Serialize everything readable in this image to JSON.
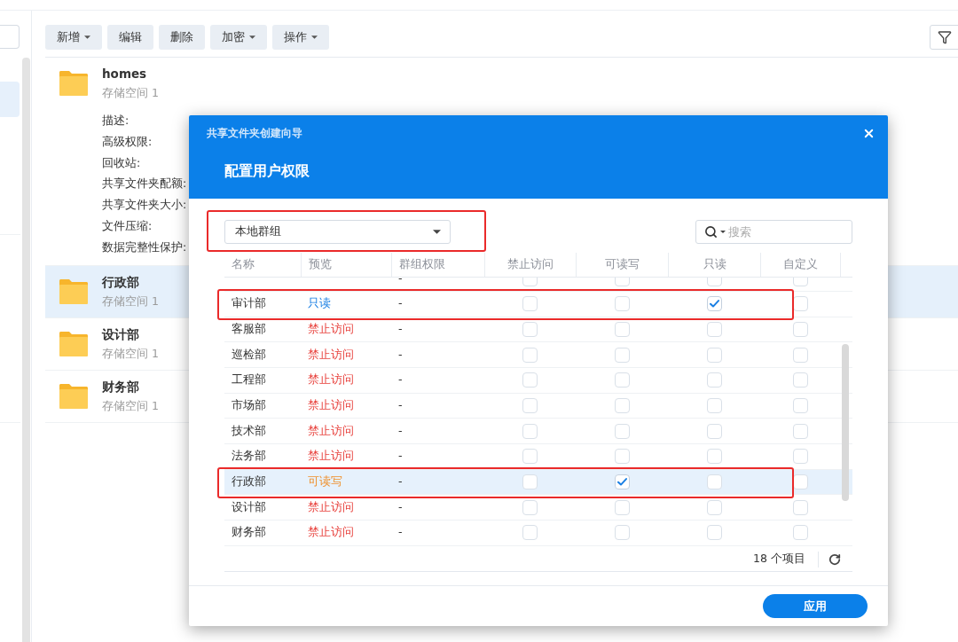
{
  "sidebar": {
    "items": [
      {
        "selected": true
      }
    ]
  },
  "toolbar": {
    "buttons": [
      {
        "label": "新增",
        "menu": true
      },
      {
        "label": "编辑",
        "menu": false
      },
      {
        "label": "删除",
        "menu": false
      },
      {
        "label": "加密",
        "menu": true
      },
      {
        "label": "操作",
        "menu": true
      }
    ]
  },
  "folders": [
    {
      "name": "homes",
      "subtitle": "存储空间 1",
      "selected": false,
      "expanded": true,
      "details": [
        "描述:",
        "高级权限:",
        "回收站:",
        "共享文件夹配额:",
        "共享文件夹大小:",
        "文件压缩:",
        "数据完整性保护:"
      ]
    },
    {
      "name": "行政部",
      "subtitle": "存储空间 1",
      "selected": true,
      "expanded": false
    },
    {
      "name": "设计部",
      "subtitle": "存储空间 1",
      "selected": false,
      "expanded": false
    },
    {
      "name": "财务部",
      "subtitle": "存储空间 1",
      "selected": false,
      "expanded": false
    }
  ],
  "dialog": {
    "title": "共享文件夹创建向导",
    "heading": "配置用户权限",
    "group_filter": {
      "value": "本地群组",
      "highlighted": true
    },
    "search": {
      "placeholder": "搜索"
    },
    "table": {
      "columns": [
        "名称",
        "预览",
        "群组权限",
        "禁止访问",
        "可读写",
        "只读",
        "自定义"
      ],
      "rows": [
        {
          "group_permission": "-",
          "checks": [
            false,
            false,
            false,
            false
          ],
          "selected": false,
          "highlighted": false
        },
        {
          "name": "审计部",
          "preview": {
            "text": "只读",
            "kind": "readonly"
          },
          "group_permission": "-",
          "checks": [
            false,
            false,
            true,
            false
          ],
          "selected": false,
          "highlighted": true
        },
        {
          "name": "客服部",
          "preview": {
            "text": "禁止访问",
            "kind": "deny"
          },
          "group_permission": "-",
          "checks": [
            false,
            false,
            false,
            false
          ],
          "selected": false,
          "highlighted": false
        },
        {
          "name": "巡检部",
          "preview": {
            "text": "禁止访问",
            "kind": "deny"
          },
          "group_permission": "-",
          "checks": [
            false,
            false,
            false,
            false
          ],
          "selected": false,
          "highlighted": false
        },
        {
          "name": "工程部",
          "preview": {
            "text": "禁止访问",
            "kind": "deny"
          },
          "group_permission": "-",
          "checks": [
            false,
            false,
            false,
            false
          ],
          "selected": false,
          "highlighted": false
        },
        {
          "name": "市场部",
          "preview": {
            "text": "禁止访问",
            "kind": "deny"
          },
          "group_permission": "-",
          "checks": [
            false,
            false,
            false,
            false
          ],
          "selected": false,
          "highlighted": false
        },
        {
          "name": "技术部",
          "preview": {
            "text": "禁止访问",
            "kind": "deny"
          },
          "group_permission": "-",
          "checks": [
            false,
            false,
            false,
            false
          ],
          "selected": false,
          "highlighted": false
        },
        {
          "name": "法务部",
          "preview": {
            "text": "禁止访问",
            "kind": "deny"
          },
          "group_permission": "-",
          "checks": [
            false,
            false,
            false,
            false
          ],
          "selected": false,
          "highlighted": false
        },
        {
          "name": "行政部",
          "preview": {
            "text": "可读写",
            "kind": "readwrite"
          },
          "group_permission": "-",
          "checks": [
            false,
            true,
            false,
            false
          ],
          "selected": true,
          "highlighted": true
        },
        {
          "name": "设计部",
          "preview": {
            "text": "禁止访问",
            "kind": "deny"
          },
          "group_permission": "-",
          "checks": [
            false,
            false,
            false,
            false
          ],
          "selected": false,
          "highlighted": false
        },
        {
          "name": "财务部",
          "preview": {
            "text": "禁止访问",
            "kind": "deny"
          },
          "group_permission": "-",
          "checks": [
            false,
            false,
            false,
            false
          ],
          "selected": false,
          "highlighted": false
        }
      ],
      "footer": {
        "count": "18 个项目"
      }
    },
    "buttons": [
      {
        "label": "应用"
      }
    ]
  }
}
